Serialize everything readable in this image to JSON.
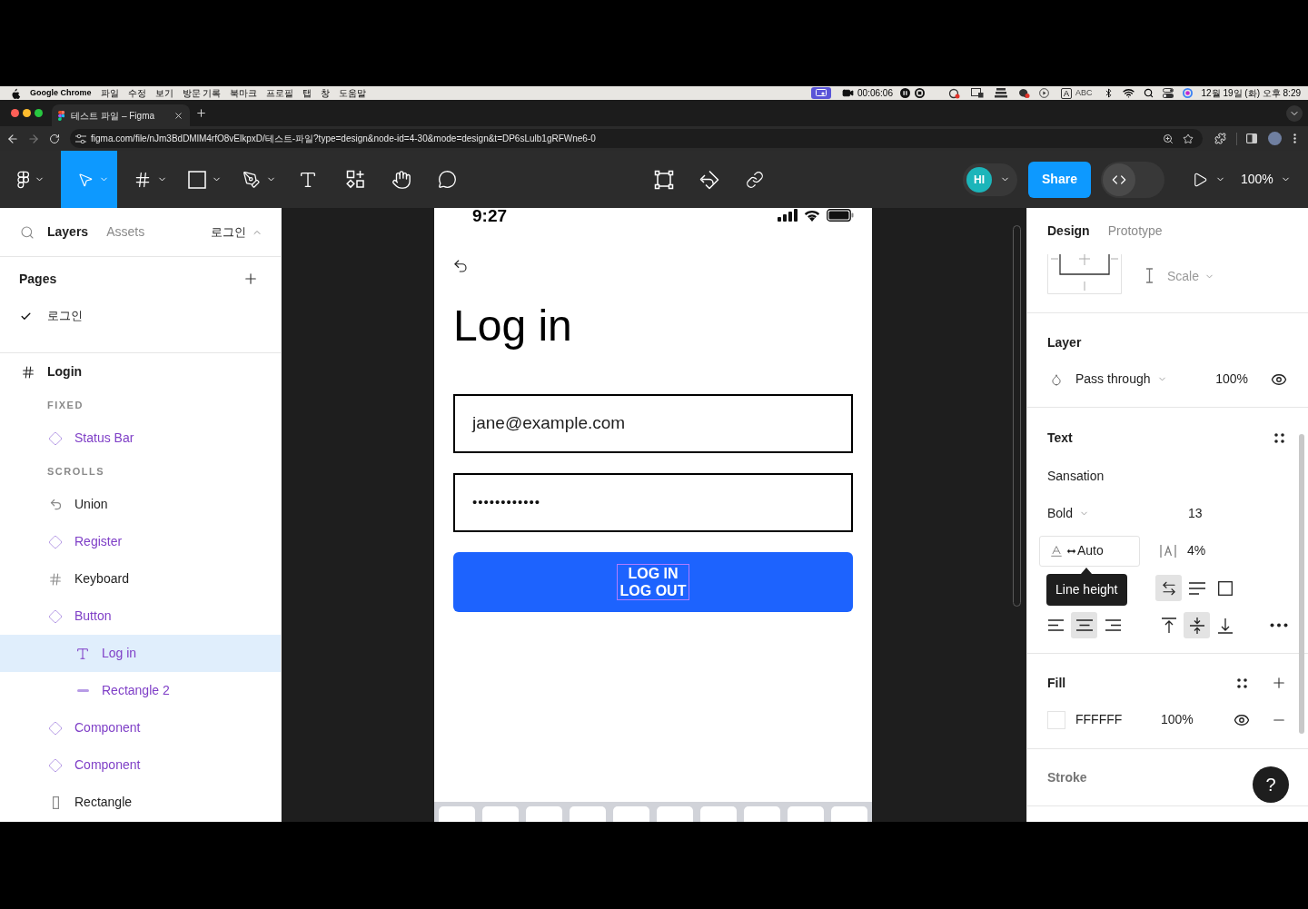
{
  "menu_bar": {
    "app": "Google Chrome",
    "menus": [
      "파일",
      "수정",
      "보기",
      "방문 기록",
      "북마크",
      "프로필",
      "탭",
      "창",
      "도움말"
    ],
    "recording_time": "00:06:06",
    "input_source": {
      "glyph": "A",
      "label": "ABC"
    },
    "clock": "12월 19일 (화) 오후 8:29"
  },
  "browser": {
    "tabs": [
      {
        "title": "테스트 파일 – Figma",
        "selected": true
      }
    ],
    "url": "figma.com/file/nJm3BdDMlM4rfO8vElkpxD/테스트-파일?type=design&node-id=4-30&mode=design&t=DP6sLulb1gRFWne6-0"
  },
  "toolbar": {
    "tools": [
      {
        "kind": "main-menu",
        "selected": false
      },
      {
        "kind": "move",
        "selected": true
      },
      {
        "kind": "frame",
        "selected": false
      },
      {
        "kind": "shape",
        "selected": false
      },
      {
        "kind": "pen",
        "selected": false
      },
      {
        "kind": "text",
        "selected": false
      },
      {
        "kind": "resources",
        "selected": false
      },
      {
        "kind": "hand",
        "selected": false
      },
      {
        "kind": "comment",
        "selected": false
      }
    ],
    "actions": [
      {
        "kind": "transform"
      },
      {
        "kind": "reset"
      },
      {
        "kind": "link"
      }
    ],
    "avatar": "HI",
    "share": "Share",
    "dev_mode": {
      "on": false
    },
    "zoom": "100%"
  },
  "left_panel": {
    "tabs": [
      {
        "label": "Layers",
        "selected": true
      },
      {
        "label": "Assets",
        "selected": false
      }
    ],
    "page_menu": "로그인",
    "pages_title": "Pages",
    "pages": [
      {
        "name": "로그인",
        "selected": true
      }
    ],
    "layers": [
      {
        "kind": "frame",
        "name": "Login",
        "selected": false,
        "children": [
          {
            "kind": "section",
            "name": "FIXED",
            "selected": false
          },
          {
            "kind": "instance",
            "name": "Status Bar",
            "selected": false
          },
          {
            "kind": "section",
            "name": "SCROLLS",
            "selected": false
          },
          {
            "kind": "vector",
            "name": "Union",
            "selected": false
          },
          {
            "kind": "instance",
            "name": "Register",
            "selected": false
          },
          {
            "kind": "frame",
            "name": "Keyboard",
            "selected": false
          },
          {
            "kind": "instance",
            "name": "Button",
            "selected": false,
            "children": [
              {
                "kind": "text",
                "name": "Log in",
                "selected": true
              },
              {
                "kind": "line",
                "name": "Rectangle 2",
                "selected": false
              }
            ]
          },
          {
            "kind": "instance",
            "name": "Component",
            "selected": false
          },
          {
            "kind": "instance",
            "name": "Component",
            "selected": false
          },
          {
            "kind": "rectangle",
            "name": "Rectangle",
            "selected": false
          }
        ]
      }
    ]
  },
  "canvas": {
    "phone": {
      "time": "9:27",
      "title": "Log in",
      "email": "jane@example.com",
      "password": "••••••••••••",
      "button": {
        "lines": [
          "LOG IN",
          "LOG OUT"
        ],
        "text_selected": true
      }
    }
  },
  "right_panel": {
    "tabs": [
      {
        "label": "Design",
        "selected": true
      },
      {
        "label": "Prototype",
        "selected": false
      }
    ],
    "constraint": "Scale",
    "layer": {
      "title": "Layer",
      "blend": "Pass through",
      "opacity": "100%",
      "visible": true
    },
    "text": {
      "title": "Text",
      "font": "Sansation",
      "weight": "Bold",
      "size": "13",
      "line_height": "Auto",
      "letter_spacing": "4%",
      "tooltip": "Line height",
      "resizing": [
        {
          "kind": "auto-width",
          "selected": true
        },
        {
          "kind": "auto-height",
          "selected": false
        },
        {
          "kind": "fixed",
          "selected": false
        }
      ],
      "align_horizontal": [
        {
          "kind": "left",
          "selected": false
        },
        {
          "kind": "center",
          "selected": true
        },
        {
          "kind": "right",
          "selected": false
        }
      ],
      "align_vertical": [
        {
          "kind": "top",
          "selected": false
        },
        {
          "kind": "middle",
          "selected": true
        },
        {
          "kind": "bottom",
          "selected": false
        }
      ]
    },
    "fill": {
      "title": "Fill",
      "hex": "FFFFFF",
      "opacity": "100%",
      "visible": true
    },
    "stroke": {
      "title": "Stroke"
    },
    "help": "?"
  }
}
